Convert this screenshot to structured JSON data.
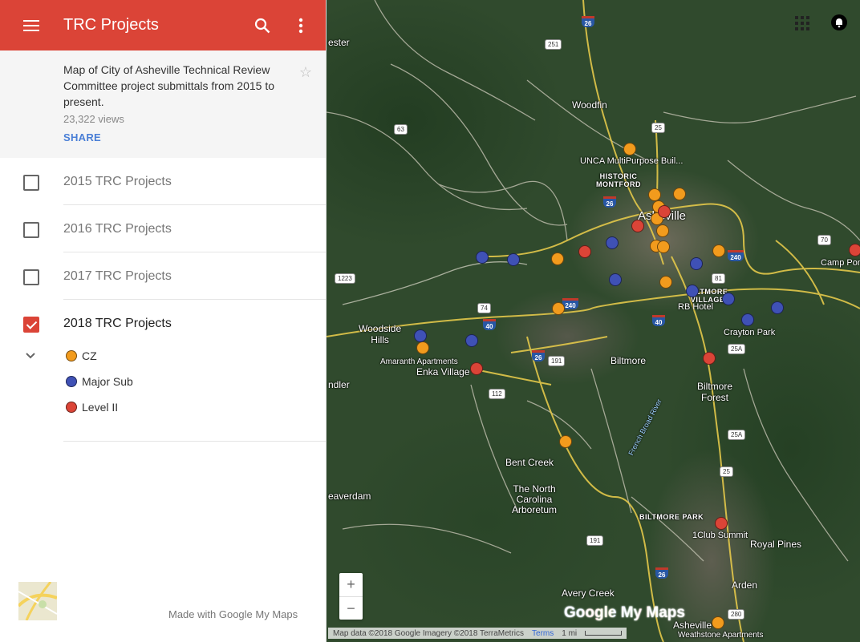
{
  "sidebar": {
    "title": "TRC Projects",
    "description": "Map of City of Asheville Technical Review Committee project submittals from 2015 to present.",
    "views": "23,322 views",
    "share_label": "SHARE",
    "layers": [
      {
        "label": "2015 TRC Projects",
        "checked": false
      },
      {
        "label": "2016 TRC Projects",
        "checked": false
      },
      {
        "label": "2017 TRC Projects",
        "checked": false
      },
      {
        "label": "2018 TRC Projects",
        "checked": true
      }
    ],
    "legend": [
      {
        "label": "CZ",
        "color": "#f29b1d"
      },
      {
        "label": "Major Sub",
        "color": "#3f51b5"
      },
      {
        "label": "Level II",
        "color": "#db4437"
      }
    ],
    "footer": "Made with Google My Maps"
  },
  "map": {
    "places": {
      "woodfin": "Woodfin",
      "historic_montford": "HISTORIC\nMONTFORD",
      "unca": "UNCA MultiPurpose Buil...",
      "asheville": "Asheville",
      "camp_pond": "Camp Pon",
      "biltmore_village": "BILTMORE\nVILLAGE",
      "rb_hotel": "RB Hotel",
      "crayton_park": "Crayton Park",
      "woodside_hills": "Woodside\nHills",
      "amaranth": "Amaranth Apartments",
      "enka_village": "Enka Village",
      "biltmore": "Biltmore",
      "biltmore_forest": "Biltmore\nForest",
      "bent_creek": "Bent Creek",
      "arboretum": "The North\nCarolina\nArboretum",
      "biltmore_park": "BILTMORE PARK",
      "club_summit": "1Club Summit",
      "royal_pines": "Royal Pines",
      "arden": "Arden",
      "avery_creek": "Avery Creek",
      "asheville_s": "Asheville",
      "weatherstone": "Weathstone Apartments",
      "beaverdam": "eaverdam",
      "ndler": "ndler",
      "ester": "ester",
      "french_broad": "French Broad River"
    },
    "route_shields": [
      "251",
      "63",
      "25",
      "70",
      "1223",
      "74",
      "81",
      "25A",
      "191",
      "112",
      "25A",
      "25",
      "191",
      "280"
    ],
    "interstate_shields": [
      "26",
      "26",
      "40",
      "240",
      "40",
      "26",
      "26",
      "240"
    ],
    "attribution": "Map data ©2018 Google Imagery ©2018 TerraMetrics",
    "terms": "Terms",
    "scale": "1 mi",
    "brand": "Google My Maps",
    "zoom_in": "+",
    "zoom_out": "−"
  }
}
